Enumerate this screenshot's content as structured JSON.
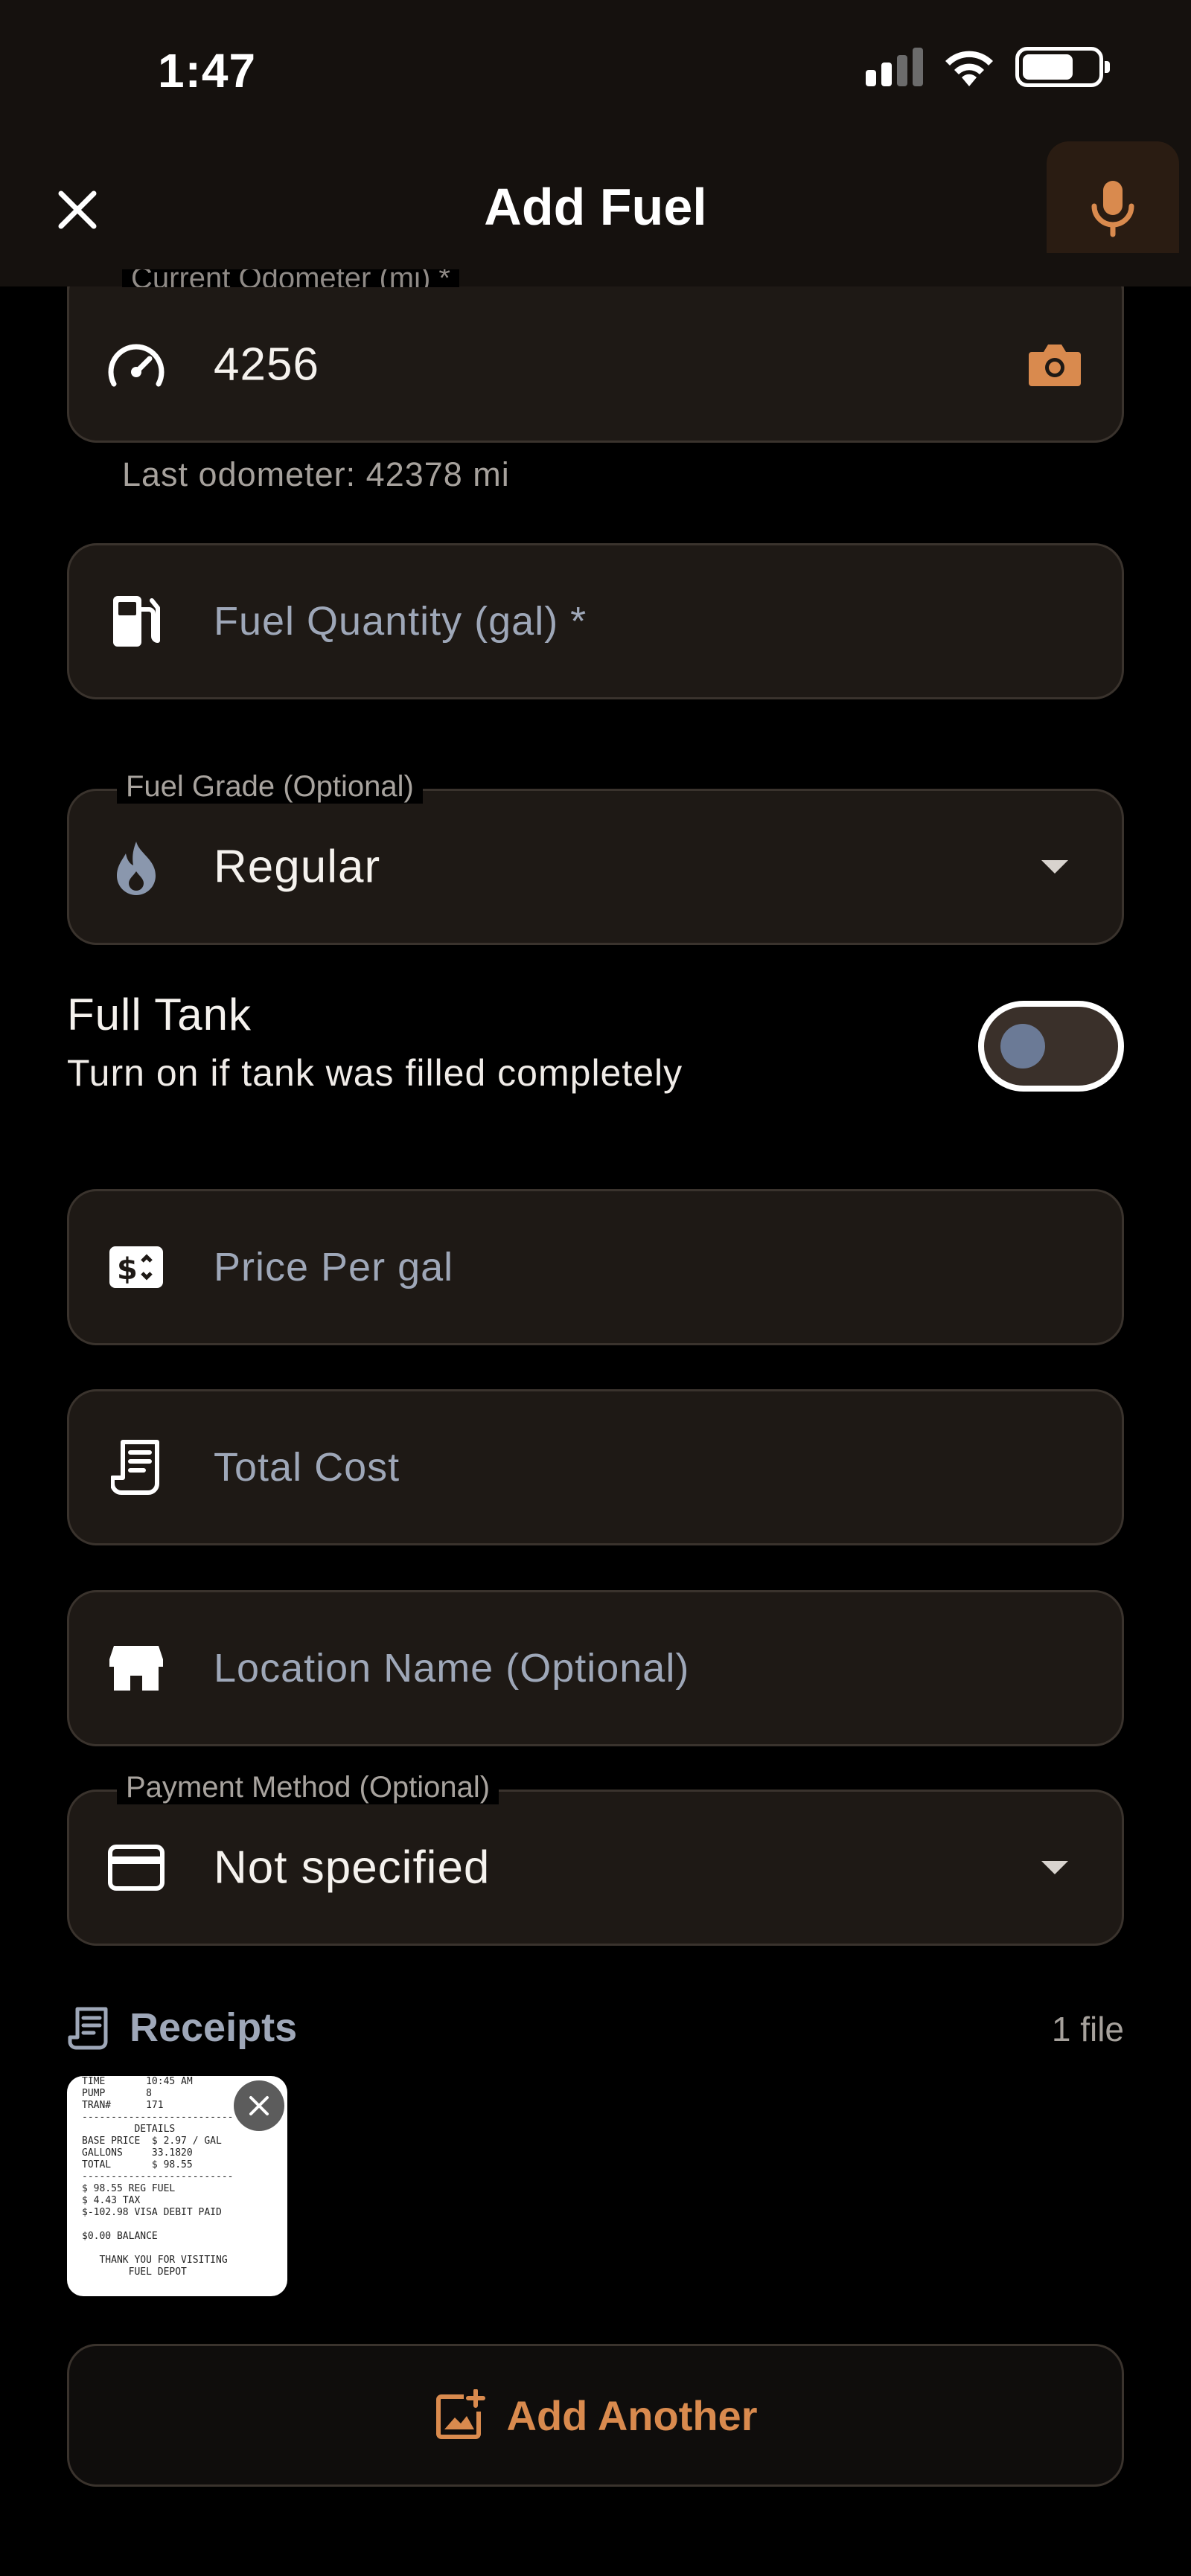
{
  "status_bar": {
    "time": "1:47"
  },
  "header": {
    "title": "Add Fuel"
  },
  "form": {
    "odometer": {
      "label": "Current Odometer (mi) *",
      "value": "4256",
      "helper": "Last odometer: 42378 mi"
    },
    "fuel_quantity": {
      "placeholder": "Fuel Quantity (gal) *"
    },
    "fuel_grade": {
      "label": "Fuel Grade (Optional)",
      "value": "Regular"
    },
    "full_tank": {
      "title": "Full Tank",
      "subtitle": "Turn on if tank was filled completely",
      "on": false
    },
    "price_per": {
      "placeholder": "Price Per gal"
    },
    "total_cost": {
      "placeholder": "Total Cost"
    },
    "location": {
      "placeholder": "Location Name (Optional)"
    },
    "payment": {
      "label": "Payment Method (Optional)",
      "value": "Not specified"
    }
  },
  "receipts": {
    "title": "Receipts",
    "count": "1 file",
    "thumbnail_text": "TIME       10:45 AM\nPUMP       8\nTRAN#      171\n--------------------------\n         DETAILS\nBASE PRICE  $ 2.97 / GAL\nGALLONS     33.1820\nTOTAL       $ 98.55\n--------------------------\n$ 98.55 REG FUEL\n$ 4.43 TAX\n$-102.98 VISA DEBIT PAID\n\n$0.00 BALANCE\n\n   THANK YOU FOR VISITING\n        FUEL DEPOT",
    "add_another_label": "Add Another"
  },
  "colors": {
    "accent": "#d98a4e",
    "field_bg": "#1e1915",
    "placeholder": "#9ea7b8"
  }
}
